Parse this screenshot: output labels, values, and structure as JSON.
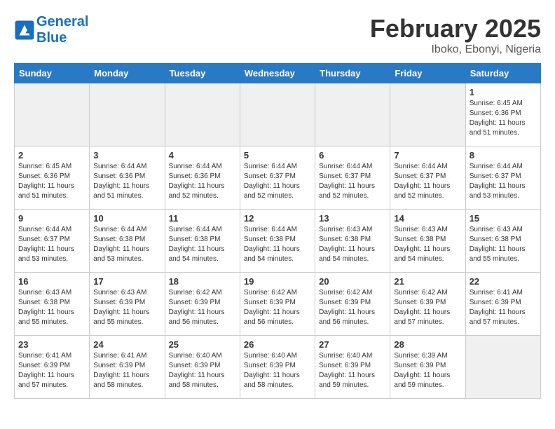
{
  "header": {
    "logo_line1": "General",
    "logo_line2": "Blue",
    "title": "February 2025",
    "subtitle": "Iboko, Ebonyi, Nigeria"
  },
  "weekdays": [
    "Sunday",
    "Monday",
    "Tuesday",
    "Wednesday",
    "Thursday",
    "Friday",
    "Saturday"
  ],
  "weeks": [
    [
      {
        "day": "",
        "info": "",
        "empty": true
      },
      {
        "day": "",
        "info": "",
        "empty": true
      },
      {
        "day": "",
        "info": "",
        "empty": true
      },
      {
        "day": "",
        "info": "",
        "empty": true
      },
      {
        "day": "",
        "info": "",
        "empty": true
      },
      {
        "day": "",
        "info": "",
        "empty": true
      },
      {
        "day": "1",
        "info": "Sunrise: 6:45 AM\nSunset: 6:36 PM\nDaylight: 11 hours\nand 51 minutes.",
        "empty": false
      }
    ],
    [
      {
        "day": "2",
        "info": "Sunrise: 6:45 AM\nSunset: 6:36 PM\nDaylight: 11 hours\nand 51 minutes.",
        "empty": false
      },
      {
        "day": "3",
        "info": "Sunrise: 6:44 AM\nSunset: 6:36 PM\nDaylight: 11 hours\nand 51 minutes.",
        "empty": false
      },
      {
        "day": "4",
        "info": "Sunrise: 6:44 AM\nSunset: 6:36 PM\nDaylight: 11 hours\nand 52 minutes.",
        "empty": false
      },
      {
        "day": "5",
        "info": "Sunrise: 6:44 AM\nSunset: 6:37 PM\nDaylight: 11 hours\nand 52 minutes.",
        "empty": false
      },
      {
        "day": "6",
        "info": "Sunrise: 6:44 AM\nSunset: 6:37 PM\nDaylight: 11 hours\nand 52 minutes.",
        "empty": false
      },
      {
        "day": "7",
        "info": "Sunrise: 6:44 AM\nSunset: 6:37 PM\nDaylight: 11 hours\nand 52 minutes.",
        "empty": false
      },
      {
        "day": "8",
        "info": "Sunrise: 6:44 AM\nSunset: 6:37 PM\nDaylight: 11 hours\nand 53 minutes.",
        "empty": false
      }
    ],
    [
      {
        "day": "9",
        "info": "Sunrise: 6:44 AM\nSunset: 6:37 PM\nDaylight: 11 hours\nand 53 minutes.",
        "empty": false
      },
      {
        "day": "10",
        "info": "Sunrise: 6:44 AM\nSunset: 6:38 PM\nDaylight: 11 hours\nand 53 minutes.",
        "empty": false
      },
      {
        "day": "11",
        "info": "Sunrise: 6:44 AM\nSunset: 6:38 PM\nDaylight: 11 hours\nand 54 minutes.",
        "empty": false
      },
      {
        "day": "12",
        "info": "Sunrise: 6:44 AM\nSunset: 6:38 PM\nDaylight: 11 hours\nand 54 minutes.",
        "empty": false
      },
      {
        "day": "13",
        "info": "Sunrise: 6:43 AM\nSunset: 6:38 PM\nDaylight: 11 hours\nand 54 minutes.",
        "empty": false
      },
      {
        "day": "14",
        "info": "Sunrise: 6:43 AM\nSunset: 6:38 PM\nDaylight: 11 hours\nand 54 minutes.",
        "empty": false
      },
      {
        "day": "15",
        "info": "Sunrise: 6:43 AM\nSunset: 6:38 PM\nDaylight: 11 hours\nand 55 minutes.",
        "empty": false
      }
    ],
    [
      {
        "day": "16",
        "info": "Sunrise: 6:43 AM\nSunset: 6:38 PM\nDaylight: 11 hours\nand 55 minutes.",
        "empty": false
      },
      {
        "day": "17",
        "info": "Sunrise: 6:43 AM\nSunset: 6:39 PM\nDaylight: 11 hours\nand 55 minutes.",
        "empty": false
      },
      {
        "day": "18",
        "info": "Sunrise: 6:42 AM\nSunset: 6:39 PM\nDaylight: 11 hours\nand 56 minutes.",
        "empty": false
      },
      {
        "day": "19",
        "info": "Sunrise: 6:42 AM\nSunset: 6:39 PM\nDaylight: 11 hours\nand 56 minutes.",
        "empty": false
      },
      {
        "day": "20",
        "info": "Sunrise: 6:42 AM\nSunset: 6:39 PM\nDaylight: 11 hours\nand 56 minutes.",
        "empty": false
      },
      {
        "day": "21",
        "info": "Sunrise: 6:42 AM\nSunset: 6:39 PM\nDaylight: 11 hours\nand 57 minutes.",
        "empty": false
      },
      {
        "day": "22",
        "info": "Sunrise: 6:41 AM\nSunset: 6:39 PM\nDaylight: 11 hours\nand 57 minutes.",
        "empty": false
      }
    ],
    [
      {
        "day": "23",
        "info": "Sunrise: 6:41 AM\nSunset: 6:39 PM\nDaylight: 11 hours\nand 57 minutes.",
        "empty": false
      },
      {
        "day": "24",
        "info": "Sunrise: 6:41 AM\nSunset: 6:39 PM\nDaylight: 11 hours\nand 58 minutes.",
        "empty": false
      },
      {
        "day": "25",
        "info": "Sunrise: 6:40 AM\nSunset: 6:39 PM\nDaylight: 11 hours\nand 58 minutes.",
        "empty": false
      },
      {
        "day": "26",
        "info": "Sunrise: 6:40 AM\nSunset: 6:39 PM\nDaylight: 11 hours\nand 58 minutes.",
        "empty": false
      },
      {
        "day": "27",
        "info": "Sunrise: 6:40 AM\nSunset: 6:39 PM\nDaylight: 11 hours\nand 59 minutes.",
        "empty": false
      },
      {
        "day": "28",
        "info": "Sunrise: 6:39 AM\nSunset: 6:39 PM\nDaylight: 11 hours\nand 59 minutes.",
        "empty": false
      },
      {
        "day": "",
        "info": "",
        "empty": true
      }
    ]
  ]
}
